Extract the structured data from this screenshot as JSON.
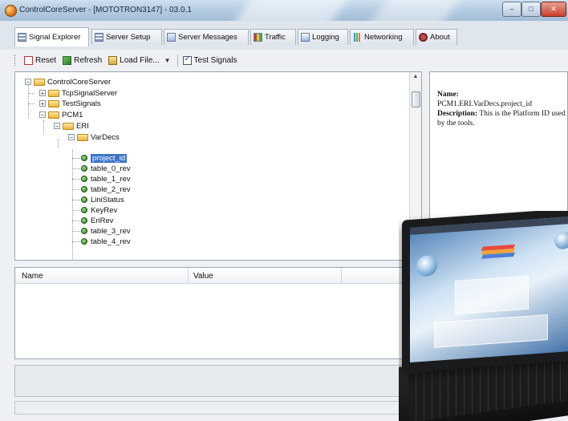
{
  "window": {
    "title": "ControlCoreServer - [MOTOTRON3147] - 03.0.1",
    "controls": {
      "minimize": "–",
      "maximize": "□",
      "close": "✕"
    }
  },
  "tabs": [
    {
      "label": "Signal Explorer",
      "icon": "signal-explorer-icon",
      "active": true
    },
    {
      "label": "Server Setup",
      "icon": "server-setup-icon"
    },
    {
      "label": "Server Messages",
      "icon": "messages-icon"
    },
    {
      "label": "Traffic",
      "icon": "traffic-icon"
    },
    {
      "label": "Logging",
      "icon": "logging-icon"
    },
    {
      "label": "Networking",
      "icon": "networking-icon"
    },
    {
      "label": "About",
      "icon": "about-icon"
    }
  ],
  "toolbar": {
    "reset_label": "Reset",
    "refresh_label": "Refresh",
    "load_file_label": "Load File...",
    "test_signals_label": "Test Signals",
    "test_signals_checked": true
  },
  "tree": {
    "root": "ControlCoreServer",
    "tcp": "TcpSignalServer",
    "test": "TestSignals",
    "pcm1": "PCM1",
    "eri": "ERI",
    "vardecs": "VarDecs",
    "signals": [
      "project_id",
      "table_0_rev",
      "table_1_rev",
      "table_2_rev",
      "LiniStatus",
      "KeyRev",
      "EriRev",
      "table_3_rev",
      "table_4_rev"
    ],
    "selected": "project_id"
  },
  "detail": {
    "name_label": "Name:",
    "name_value": "PCM1.ERI.VarDecs.project_id",
    "description_label": "Description:",
    "description_value": "This is the Platform ID used by the tools."
  },
  "grid": {
    "columns": [
      "Name",
      "Value"
    ]
  },
  "colors": {
    "selection": "#3b73c8",
    "titlebar": "#b6cde3",
    "tab_strip": "#dfe6ee"
  }
}
